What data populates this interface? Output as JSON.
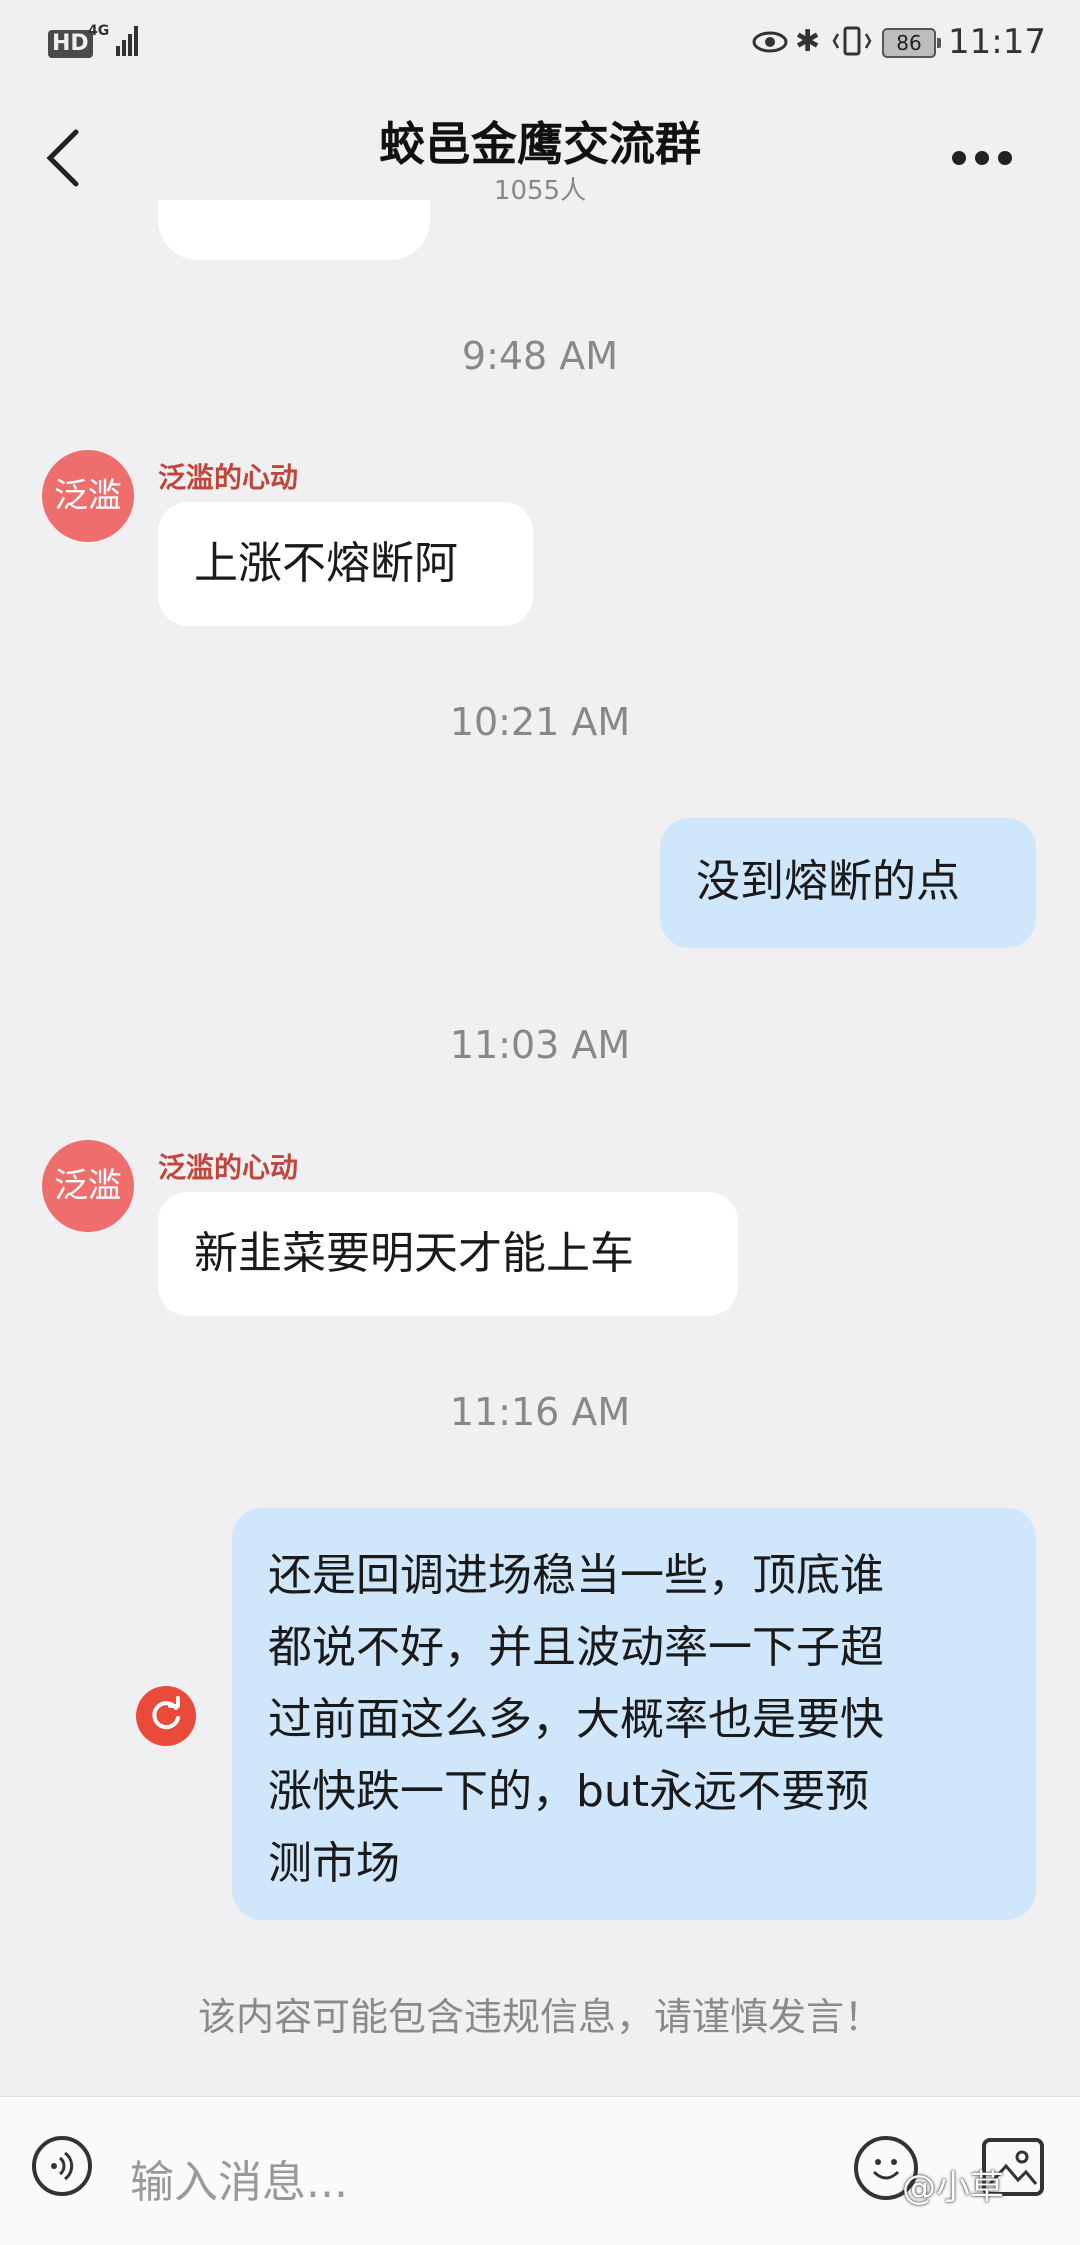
{
  "status_bar": {
    "hd": "HD",
    "network": "4G",
    "battery": "86",
    "time": "11:17"
  },
  "header": {
    "title": "蛟邑金鹰交流群",
    "member_count": "1055人"
  },
  "messages": [
    {
      "timestamp": "9:48 AM"
    },
    {
      "avatar_text": "泛滥",
      "sender": "泛滥的心动",
      "text": "上涨不熔断阿"
    },
    {
      "timestamp": "10:21 AM"
    },
    {
      "text": "没到熔断的点"
    },
    {
      "timestamp": "11:03 AM"
    },
    {
      "avatar_text": "泛滥",
      "sender": "泛滥的心动",
      "text": "新韭菜要明天才能上车"
    },
    {
      "timestamp": "11:16 AM"
    },
    {
      "lines": [
        "还是回调进场稳当一些，顶底谁",
        "都说不好，并且波动率一下子超",
        "过前面这么多，大概率也是要快",
        "涨快跌一下的，but永远不要预",
        "测市场"
      ]
    }
  ],
  "warning": "该内容可能包含违规信息，请谨慎发言！",
  "input": {
    "placeholder": "输入消息..."
  },
  "watermark": "@小草",
  "colors": {
    "background": "#f0f0f2",
    "outgoing_bubble": "#cfe6fb",
    "incoming_bubble": "#ffffff",
    "avatar": "#ee6e6e",
    "sender_name": "#c0463c",
    "retry": "#ea4a3a"
  }
}
